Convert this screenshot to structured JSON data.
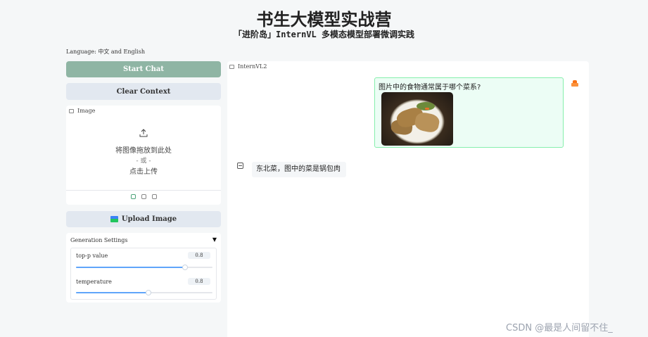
{
  "header": {
    "title": "书生大模型实战营",
    "subtitle": "「进阶岛」InternVL 多模态模型部署微调实践"
  },
  "language_note": "Language: 中文 and English",
  "buttons": {
    "start_chat": "Start Chat",
    "clear_context": "Clear Context",
    "upload_image": "Upload Image"
  },
  "image_panel": {
    "label": "Image",
    "drop_text": "将图像拖放到此处",
    "or_text": "- 或 -",
    "click_text": "点击上传"
  },
  "generation_settings": {
    "title": "Generation Settings",
    "sliders": [
      {
        "label": "top-p value",
        "value": "0.8",
        "fraction": 0.8
      },
      {
        "label": "temperature",
        "value": "0.8",
        "fraction": 0.53
      }
    ]
  },
  "chat": {
    "tab_label": "InternVL2",
    "messages": [
      {
        "role": "user",
        "text": "图片中的食物通常属于哪个菜系?"
      },
      {
        "role": "assistant",
        "text": "东北菜，图中的菜是锅包肉"
      }
    ]
  },
  "watermark": "CSDN @最是人间留不住_",
  "icons": [
    "upload-icon",
    "image-icon",
    "chatbot-icon",
    "user-avatar-icon",
    "bot-avatar-icon"
  ]
}
